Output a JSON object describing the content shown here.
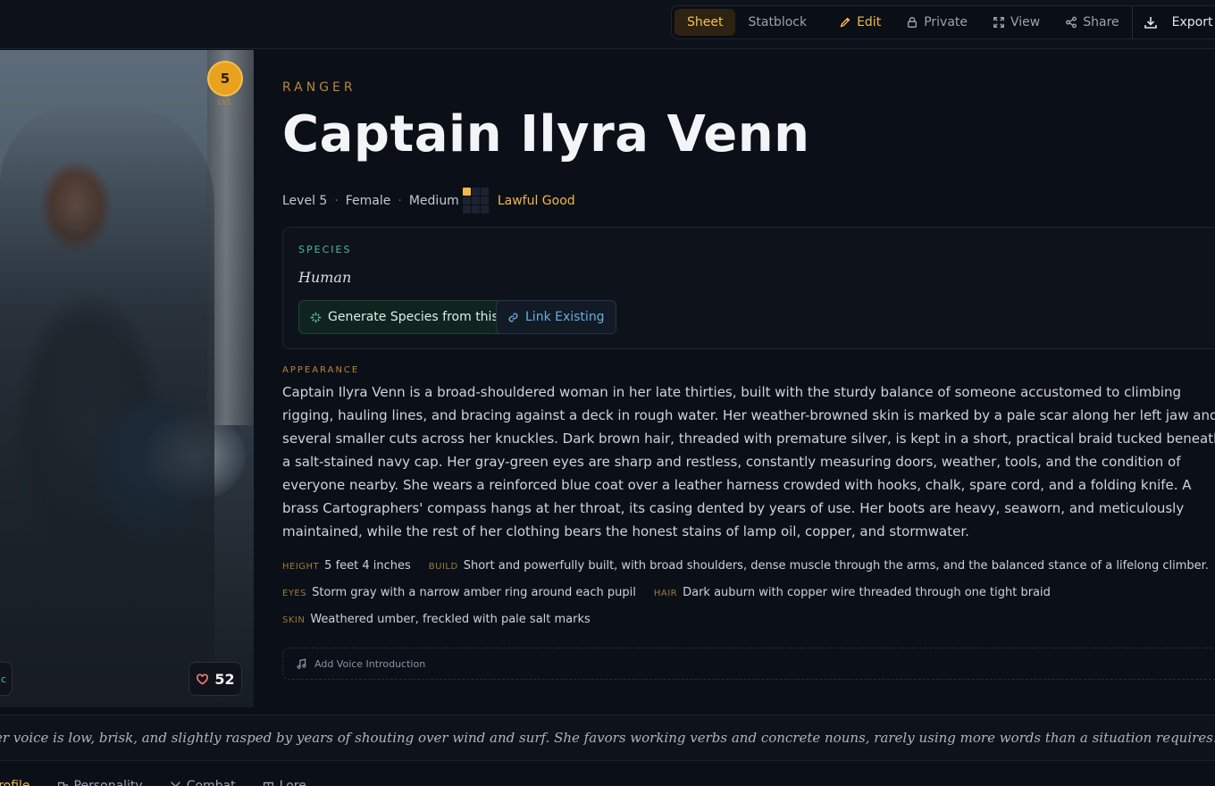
{
  "toolbar": {
    "sheet": "Sheet",
    "statblock": "Statblock",
    "edit": "Edit",
    "private": "Private",
    "view": "View",
    "share": "Share",
    "export": "Export"
  },
  "portrait": {
    "level_number": "5",
    "level_caption": "LVL",
    "likes": "52",
    "side_tab_glyph": "c"
  },
  "character": {
    "class": "RANGER",
    "name": "Captain Ilyra Venn",
    "level": "Level 5",
    "gender": "Female",
    "size": "Medium",
    "alignment": "Lawful Good",
    "separator": "·"
  },
  "species": {
    "label": "SPECIES",
    "value": "Human",
    "generate_button": "Generate Species from this",
    "link_button": "Link Existing"
  },
  "appearance": {
    "label": "APPEARANCE",
    "text": "Captain Ilyra Venn is a broad-shouldered woman in her late thirties, built with the sturdy balance of someone accustomed to climbing rigging, hauling lines, and bracing against a deck in rough water. Her weather-browned skin is marked by a pale scar along her left jaw and several smaller cuts across her knuckles. Dark brown hair, threaded with premature silver, is kept in a short, practical braid tucked beneath a salt-stained navy cap. Her gray-green eyes are sharp and restless, constantly measuring doors, weather, tools, and the condition of everyone nearby. She wears a reinforced blue coat over a leather harness crowded with hooks, chalk, spare cord, and a folding knife. A brass Cartographers' compass hangs at her throat, its casing dented by years of use. Her boots are heavy, seaworn, and meticulously maintained, while the rest of her clothing bears the honest stains of lamp oil, copper, and stormwater."
  },
  "traits": {
    "height": {
      "key": "HEIGHT",
      "value": "5 feet 4 inches"
    },
    "build": {
      "key": "BUILD",
      "value": "Short and powerfully built, with broad shoulders, dense muscle through the arms, and the balanced stance of a lifelong climber."
    },
    "eyes": {
      "key": "EYES",
      "value": "Storm gray with a narrow amber ring around each pupil"
    },
    "hair": {
      "key": "HAIR",
      "value": "Dark auburn with copper wire threaded through one tight braid"
    },
    "skin": {
      "key": "SKIN",
      "value": "Weathered umber, freckled with pale salt marks"
    }
  },
  "voice": {
    "add_label": "Add Voice Introduction",
    "quote": "er voice is low, brisk, and slightly rasped by years of shouting over wind and surf. She favors working verbs and concrete nouns, rarely using more words than a situation requires.”"
  },
  "bottom_tabs": [
    "Profile",
    "Personality",
    "Combat",
    "Lore"
  ],
  "colors": {
    "accent": "#f0b94a",
    "species_accent": "#4bb89a",
    "link_blue": "#6aaed8",
    "background": "#0b0f17"
  },
  "alignment_grid": [
    1,
    0,
    0,
    0,
    0,
    0,
    0,
    0,
    0
  ]
}
